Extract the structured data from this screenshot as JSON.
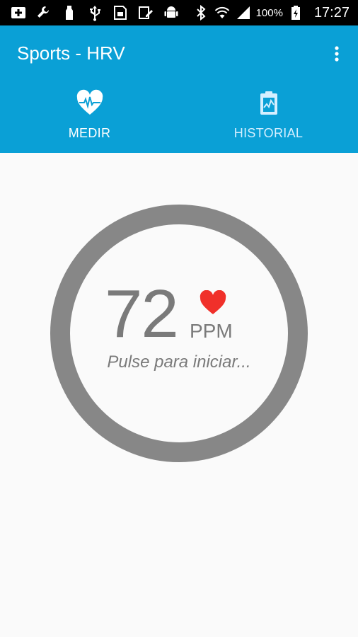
{
  "status_bar": {
    "notification_icons": [
      "add-box-icon",
      "wrench-icon",
      "bottle-icon",
      "usb-icon",
      "sim-icon",
      "edit-icon",
      "android-icon"
    ],
    "system_icons": [
      "bluetooth-icon",
      "wifi-icon",
      "signal-icon",
      "battery-icon"
    ],
    "battery_percent": "100%",
    "time": "17:27"
  },
  "app_bar": {
    "title": "Sports - HRV",
    "background_color": "#0aa0d6"
  },
  "tabs": [
    {
      "label": "MEDIR",
      "icon": "heart-pulse-icon",
      "selected": true
    },
    {
      "label": "HISTORIAL",
      "icon": "clipboard-chart-icon",
      "selected": false
    }
  ],
  "tab_indicator_color": "#e34a9c",
  "measure": {
    "bpm_value": "72",
    "unit": "PPM",
    "prompt": "Pulse para iniciar...",
    "heart_color": "#f0302a",
    "ring_color": "#878787"
  }
}
